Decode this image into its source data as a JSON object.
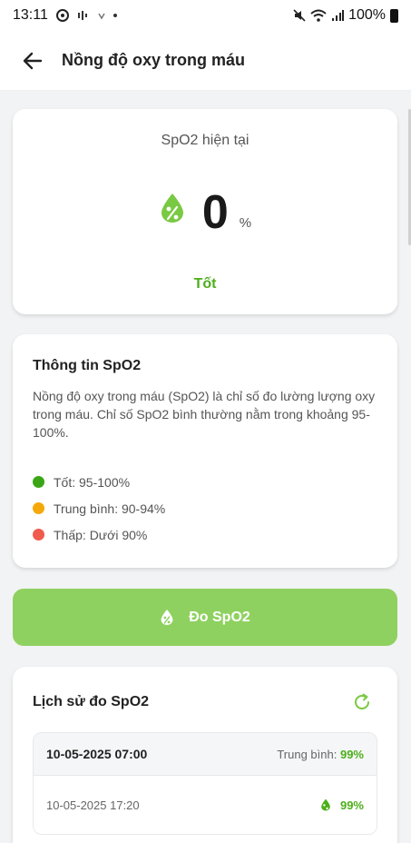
{
  "status_bar": {
    "time": "13:11",
    "battery": "100%"
  },
  "app_bar": {
    "title": "Nồng độ oxy trong máu"
  },
  "current": {
    "label": "SpO2 hiện tại",
    "value": "0",
    "unit": "%",
    "status": "Tốt"
  },
  "info": {
    "title": "Thông tin SpO2",
    "description": "Nồng độ oxy trong máu (SpO2) là chỉ số đo lường lượng oxy trong máu. Chỉ số SpO2 bình thường nằm trong khoảng 95-100%.",
    "legend": [
      {
        "label": "Tốt: 95-100%",
        "color": "#3aa616"
      },
      {
        "label": "Trung bình: 90-94%",
        "color": "#f4a90a"
      },
      {
        "label": "Thấp: Dưới 90%",
        "color": "#ef5b4c"
      }
    ]
  },
  "measure_button": {
    "label": "Đo SpO2"
  },
  "history": {
    "title": "Lịch sử đo SpO2",
    "groups": [
      {
        "date": "10-05-2025 07:00",
        "avg_label": "Trung bình: ",
        "avg_value": "99%",
        "rows": [
          {
            "time": "10-05-2025 17:20",
            "value": "99%"
          }
        ]
      }
    ]
  },
  "colors": {
    "accent_green": "#4caf1a",
    "button_green": "#8fd160",
    "icon_green": "#7ac943"
  }
}
